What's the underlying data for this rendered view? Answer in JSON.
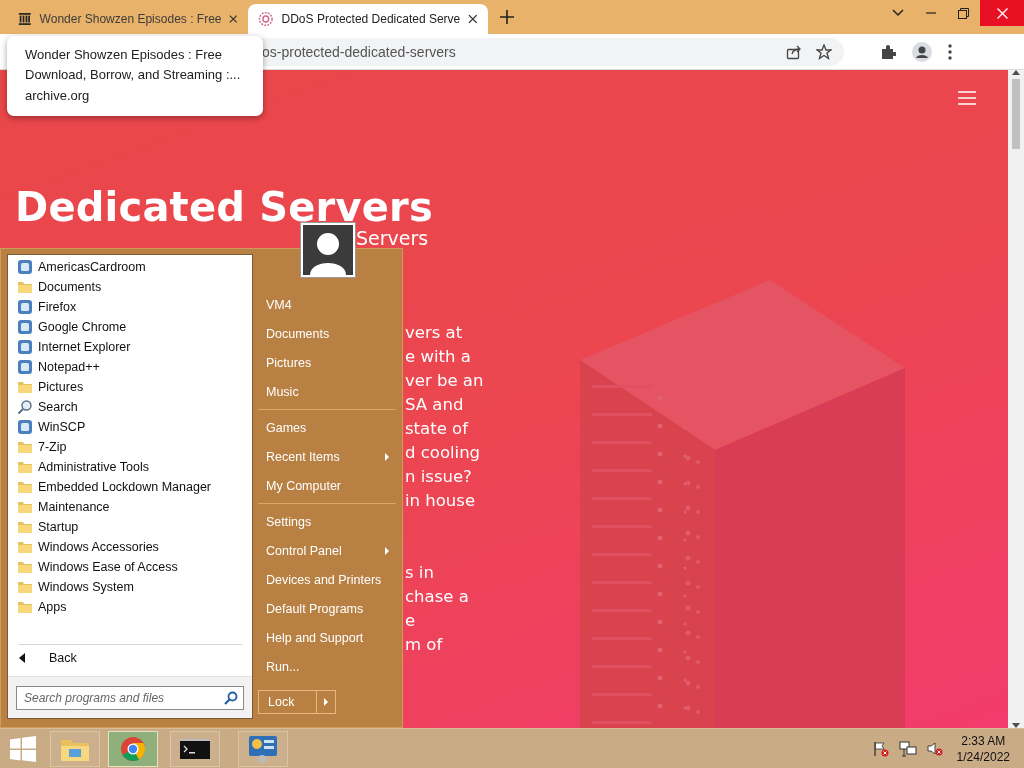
{
  "browser": {
    "tabs": [
      {
        "title": "Wonder Showzen Episodes : Free",
        "selected": false
      },
      {
        "title": "DDoS Protected Dedicated Serve",
        "selected": true
      }
    ],
    "address": "os-protected-dedicated-servers",
    "tooltip": {
      "title": "Wonder Showzen Episodes : Free Download, Borrow, and Streaming :...",
      "domain": "archive.org"
    }
  },
  "page": {
    "heading": "Dedicated Servers",
    "subtitle": "Servers",
    "paragraphs": [
      [
        "vers at",
        "e with a",
        "ver be an",
        "SA and",
        "state of",
        "d cooling",
        "n issue?",
        "in house"
      ],
      [
        "s in",
        "chase a",
        "e",
        "m of"
      ]
    ]
  },
  "start_menu": {
    "programs": [
      {
        "label": "AmericasCardroom",
        "kind": "program"
      },
      {
        "label": "Documents",
        "kind": "folder"
      },
      {
        "label": "Firefox",
        "kind": "program"
      },
      {
        "label": "Google Chrome",
        "kind": "program"
      },
      {
        "label": "Internet Explorer",
        "kind": "program"
      },
      {
        "label": "Notepad++",
        "kind": "program"
      },
      {
        "label": "Pictures",
        "kind": "folder"
      },
      {
        "label": "Search",
        "kind": "search"
      },
      {
        "label": "WinSCP",
        "kind": "program"
      },
      {
        "label": "7-Zip",
        "kind": "folder"
      },
      {
        "label": "Administrative Tools",
        "kind": "folder"
      },
      {
        "label": "Embedded Lockdown Manager",
        "kind": "folder"
      },
      {
        "label": "Maintenance",
        "kind": "folder"
      },
      {
        "label": "Startup",
        "kind": "folder"
      },
      {
        "label": "Windows Accessories",
        "kind": "folder"
      },
      {
        "label": "Windows Ease of Access",
        "kind": "folder"
      },
      {
        "label": "Windows System",
        "kind": "folder"
      },
      {
        "label": "Apps",
        "kind": "folder"
      }
    ],
    "back": "Back",
    "search": {
      "placeholder": "Search programs and files"
    },
    "places": [
      [
        {
          "label": "VM4",
          "submenu": false
        },
        {
          "label": "Documents",
          "submenu": false
        },
        {
          "label": "Pictures",
          "submenu": false
        },
        {
          "label": "Music",
          "submenu": false
        }
      ],
      [
        {
          "label": "Games",
          "submenu": false
        },
        {
          "label": "Recent Items",
          "submenu": true
        },
        {
          "label": "My Computer",
          "submenu": false
        }
      ],
      [
        {
          "label": "Settings",
          "submenu": false
        },
        {
          "label": "Control Panel",
          "submenu": true
        },
        {
          "label": "Devices and Printers",
          "submenu": false
        },
        {
          "label": "Default Programs",
          "submenu": false
        },
        {
          "label": "Help and Support",
          "submenu": false
        },
        {
          "label": "Run...",
          "submenu": false
        }
      ]
    ],
    "lock": "Lock"
  },
  "taskbar": {
    "apps": [
      {
        "kind": "files",
        "selected": false
      },
      {
        "kind": "browser",
        "selected": true
      },
      {
        "kind": "terminal",
        "selected": false
      },
      {
        "kind": "panel",
        "selected": false
      }
    ],
    "time": "2:33 AM",
    "date": "1/24/2022"
  }
}
